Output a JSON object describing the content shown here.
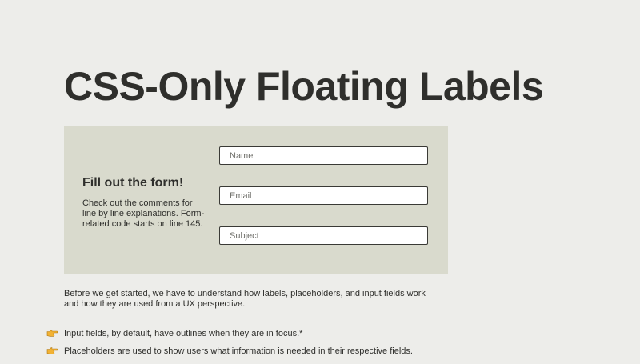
{
  "page": {
    "title": "CSS-Only Floating Labels"
  },
  "form": {
    "heading": "Fill out the form!",
    "description": "Check out the comments for line by line explanations. Form-related code starts on line 145.",
    "fields": {
      "name_placeholder": "Name",
      "email_placeholder": "Email",
      "subject_placeholder": "Subject"
    }
  },
  "article": {
    "intro": "Before we get started, we have to understand how labels, placeholders, and input fields work and how they are used from a UX perspective.",
    "bullets": [
      {
        "icon": "pointing-hand-icon",
        "text": "Input fields, by default, have outlines when they are in focus.*"
      },
      {
        "icon": "pointing-hand-icon",
        "text": "Placeholders are used to show users what information is needed in their respective fields."
      }
    ]
  },
  "colors": {
    "background": "#ededea",
    "panel": "#d9dacd",
    "text": "#2f2f2c",
    "icon": "#f2b233"
  }
}
